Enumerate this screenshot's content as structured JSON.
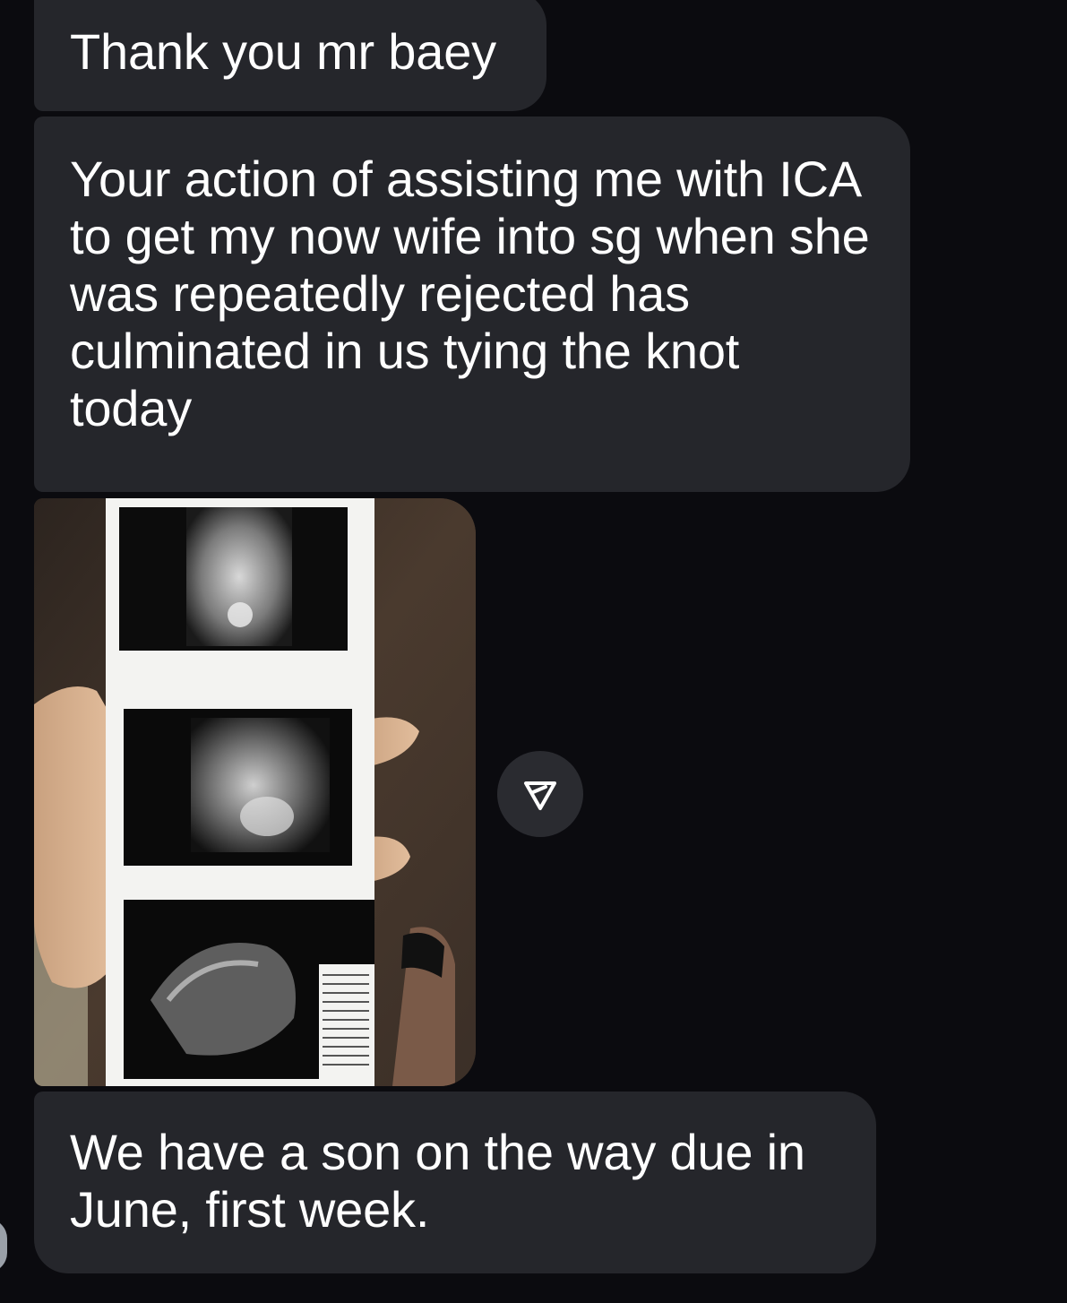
{
  "messages": [
    {
      "text": "Thank you mr baey"
    },
    {
      "text": "Your action of assisting me with ICA to get my now wife into sg when she was repeatedly rejected has culminated in us tying the knot today"
    },
    {
      "image": {
        "alt": ""
      }
    },
    {
      "text": "We have a son on the way due in June, first week."
    }
  ],
  "icons": {
    "share": "share-icon",
    "avatar": "avatar"
  },
  "colors": {
    "background": "#0b0b0f",
    "bubble": "#25262b",
    "text": "#ffffff",
    "share_button": "#2a2b30"
  }
}
